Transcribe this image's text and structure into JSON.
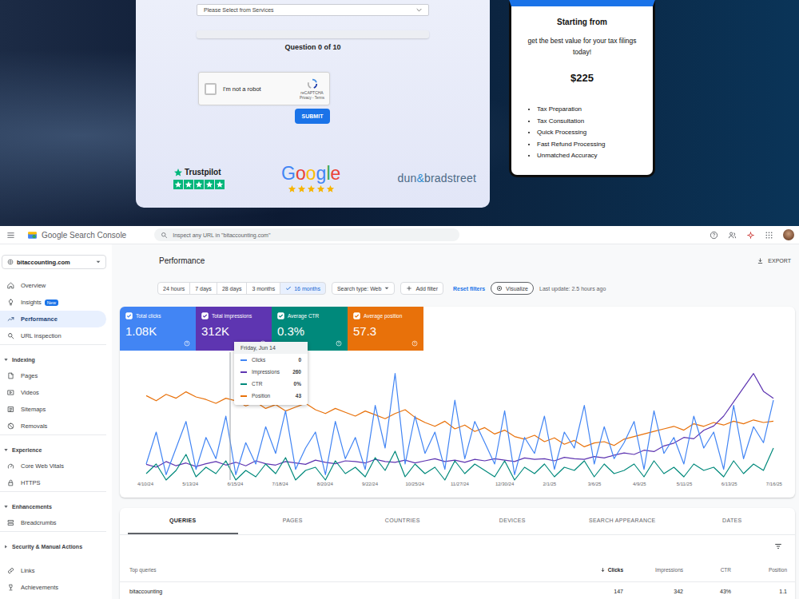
{
  "site": {
    "form": {
      "select_placeholder": "Please Select from Services",
      "progress": {
        "level": 0,
        "label": "Question 0 of 10"
      },
      "captcha": {
        "label": "I'm not a robot",
        "checked": false,
        "brand": "reCAPTCHA",
        "links": "Privacy - Terms"
      },
      "submit": "SUBMIT",
      "trustpilot": {
        "name": "Trustpilot",
        "stars": 5
      },
      "google": {
        "letters": [
          {
            "char": "G",
            "color": "#4285f4"
          },
          {
            "char": "o",
            "color": "#ea4335"
          },
          {
            "char": "o",
            "color": "#fbbc05"
          },
          {
            "char": "g",
            "color": "#4285f4"
          },
          {
            "char": "l",
            "color": "#34a853"
          },
          {
            "char": "e",
            "color": "#ea4335"
          }
        ],
        "stars": 5
      },
      "dnb": {
        "parts": [
          {
            "text": "dun",
            "color": "#4d6a86"
          },
          {
            "text": "&",
            "color": "#2f8fd3"
          },
          {
            "text": "bradstreet",
            "color": "#4d6a86"
          }
        ]
      }
    },
    "price_card": {
      "heading": "Starting from",
      "tagline": "get the best value for your tax filings today!",
      "price": "$225",
      "features": [
        "Tax Preparation",
        "Tax Consultation",
        "Quick Processing",
        "Fast Refund Processing",
        "Unmatched Accuracy"
      ]
    }
  },
  "console": {
    "header": {
      "product": "Google Search Console",
      "search_placeholder": "Inspect any URL in \"bitaccounting.com\""
    },
    "sidebar": {
      "property": "bitaccounting.com",
      "items": [
        {
          "kind": "item",
          "label": "Overview",
          "selected": false
        },
        {
          "kind": "item",
          "label": "Insights",
          "selected": false,
          "badge": "New"
        },
        {
          "kind": "item",
          "label": "Performance",
          "selected": true
        },
        {
          "kind": "item",
          "label": "URL inspection",
          "selected": false
        },
        {
          "kind": "section",
          "label": "Indexing",
          "expanded": true
        },
        {
          "kind": "item",
          "label": "Pages",
          "selected": false
        },
        {
          "kind": "item",
          "label": "Videos",
          "selected": false
        },
        {
          "kind": "item",
          "label": "Sitemaps",
          "selected": false
        },
        {
          "kind": "item",
          "label": "Removals",
          "selected": false
        },
        {
          "kind": "section",
          "label": "Experience",
          "expanded": true
        },
        {
          "kind": "item",
          "label": "Core Web Vitals",
          "selected": false
        },
        {
          "kind": "item",
          "label": "HTTPS",
          "selected": false
        },
        {
          "kind": "section",
          "label": "Enhancements",
          "expanded": true
        },
        {
          "kind": "item",
          "label": "Breadcrumbs",
          "selected": false
        },
        {
          "kind": "section",
          "label": "Security & Manual Actions",
          "expanded": false
        },
        {
          "kind": "item",
          "label": "Links",
          "selected": false
        },
        {
          "kind": "item",
          "label": "Achievements",
          "selected": false
        }
      ]
    },
    "page": {
      "title": "Performance",
      "export": "EXPORT"
    },
    "filters": {
      "ranges": [
        {
          "label": "24 hours",
          "selected": false
        },
        {
          "label": "7 days",
          "selected": false
        },
        {
          "label": "28 days",
          "selected": false
        },
        {
          "label": "3 months",
          "selected": false
        },
        {
          "label": "16 months",
          "selected": true
        }
      ],
      "search_type": "Search type: Web",
      "add_filter": "Add filter",
      "reset": "Reset filters",
      "visualize": "Visualize",
      "last_update": "Last update: 2.5 hours ago"
    },
    "metrics": [
      {
        "label": "Total clicks",
        "value": "1.08K",
        "checked": true,
        "color": "#4285f4"
      },
      {
        "label": "Total impressions",
        "value": "312K",
        "checked": true,
        "color": "#5e35b1"
      },
      {
        "label": "Average CTR",
        "value": "0.3%",
        "checked": true,
        "color": "#00897b"
      },
      {
        "label": "Average position",
        "value": "57.3",
        "checked": true,
        "color": "#e8710a"
      }
    ],
    "chart": {
      "x_labels": [
        "4/10/24",
        "5/13/24",
        "6/15/24",
        "7/18/24",
        "8/20/24",
        "9/22/24",
        "10/25/24",
        "11/27/24",
        "12/30/24",
        "2/1/25",
        "3/6/25",
        "4/9/25",
        "5/11/25",
        "6/13/25",
        "7/16/25"
      ],
      "series": [
        {
          "color": "#e8710a",
          "invert": true,
          "axis_min": 0,
          "axis_max": 100,
          "values": [
            34,
            38,
            33,
            36,
            31,
            35,
            37,
            40,
            36,
            38,
            42,
            39,
            44,
            41,
            46,
            43,
            40,
            45,
            48,
            44,
            47,
            50,
            46,
            49,
            52,
            48,
            45,
            51,
            55,
            58,
            54,
            60,
            57,
            62,
            59,
            64,
            61,
            66,
            68,
            65,
            70,
            67,
            72,
            69,
            74,
            71,
            70,
            73,
            68,
            66,
            64,
            62,
            60,
            58,
            61,
            56,
            58,
            55,
            57,
            54,
            56,
            53,
            55,
            54
          ]
        },
        {
          "color": "#5e35b1",
          "invert": false,
          "axis_min": 0,
          "axis_max": 1800,
          "values": [
            220,
            180,
            260,
            200,
            240,
            190,
            230,
            260,
            210,
            250,
            200,
            270,
            230,
            210,
            260,
            240,
            220,
            280,
            250,
            230,
            270,
            260,
            240,
            290,
            260,
            250,
            280,
            240,
            270,
            300,
            260,
            280,
            250,
            290,
            270,
            300,
            280,
            260,
            310,
            290,
            300,
            270,
            320,
            300,
            290,
            330,
            310,
            350,
            380,
            360,
            420,
            400,
            480,
            520,
            600,
            580,
            700,
            760,
            900,
            1100,
            1300,
            1500,
            1250,
            1150
          ]
        },
        {
          "color": "#00897b",
          "invert": false,
          "axis_min": 0,
          "axis_max": 40,
          "values": [
            2,
            5,
            0,
            3,
            8,
            1,
            4,
            2,
            6,
            0,
            3,
            1,
            5,
            2,
            7,
            0,
            3,
            4,
            0,
            6,
            2,
            4,
            1,
            7,
            3,
            9,
            1,
            5,
            2,
            4,
            0,
            6,
            2,
            5,
            3,
            1,
            6,
            0,
            4,
            2,
            5,
            1,
            4,
            3,
            6,
            1,
            5,
            2,
            3,
            5,
            1,
            6,
            2,
            4,
            1,
            5,
            3,
            4,
            1,
            6,
            2,
            5,
            3,
            10
          ]
        },
        {
          "color": "#4285f4",
          "invert": false,
          "axis_min": 0,
          "axis_max": 24,
          "values": [
            3,
            9,
            1,
            6,
            11,
            2,
            8,
            4,
            12,
            1,
            7,
            3,
            10,
            5,
            13,
            2,
            6,
            9,
            1,
            11,
            4,
            8,
            2,
            14,
            6,
            20,
            3,
            12,
            5,
            9,
            2,
            15,
            4,
            11,
            7,
            3,
            13,
            1,
            8,
            5,
            12,
            2,
            9,
            6,
            14,
            3,
            10,
            4,
            7,
            11,
            2,
            13,
            5,
            8,
            3,
            12,
            6,
            9,
            2,
            14,
            4,
            10,
            7,
            15
          ]
        }
      ]
    },
    "tooltip": {
      "title": "Friday, Jun 14",
      "rows": [
        {
          "label": "Clicks",
          "value": "0",
          "color": "#4285f4"
        },
        {
          "label": "Impressions",
          "value": "260",
          "color": "#5e35b1"
        },
        {
          "label": "CTR",
          "value": "0%",
          "color": "#00897b"
        },
        {
          "label": "Position",
          "value": "43",
          "color": "#e8710a"
        }
      ]
    },
    "tabs": [
      {
        "label": "QUERIES",
        "selected": true
      },
      {
        "label": "PAGES",
        "selected": false
      },
      {
        "label": "COUNTRIES",
        "selected": false
      },
      {
        "label": "DEVICES",
        "selected": false
      },
      {
        "label": "SEARCH APPEARANCE",
        "selected": false
      },
      {
        "label": "DATES",
        "selected": false
      }
    ],
    "table": {
      "columns": [
        {
          "label": "Top queries",
          "sorted": false
        },
        {
          "label": "Clicks",
          "sorted": true
        },
        {
          "label": "Impressions",
          "sorted": false
        },
        {
          "label": "CTR",
          "sorted": false
        },
        {
          "label": "Position",
          "sorted": false
        }
      ],
      "rows": [
        [
          "bitaccounting",
          "147",
          "342",
          "43%",
          "1.1"
        ]
      ]
    }
  }
}
